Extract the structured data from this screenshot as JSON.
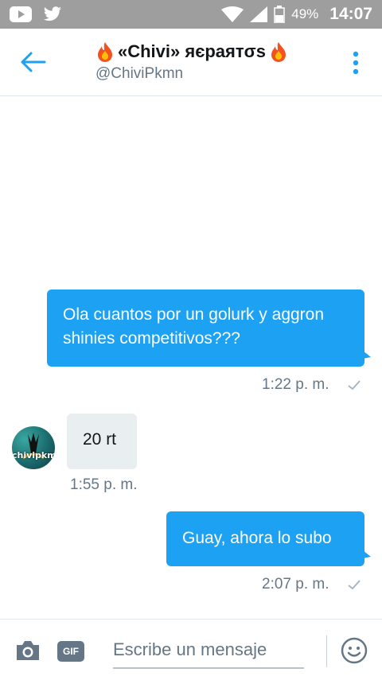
{
  "status_bar": {
    "battery_percent": "49%",
    "time": "14:07"
  },
  "header": {
    "title": "«Chivi» яєраятσѕ",
    "handle": "@ChiviPkmn"
  },
  "messages": [
    {
      "direction": "sent",
      "text": "Ola cuantos por un golurk y aggron shinies competitivos???",
      "time": "1:22 p. m."
    },
    {
      "direction": "received",
      "text": "20 rt",
      "time": "1:55 p. m."
    },
    {
      "direction": "sent",
      "text": "Guay, ahora lo subo",
      "time": "2:07 p. m."
    }
  ],
  "avatar": {
    "label": "chivipkmn"
  },
  "composer": {
    "gif_label": "GIF",
    "placeholder": "Escribe un mensaje"
  },
  "colors": {
    "accent": "#1da1f2",
    "status_bar": "#9e9e9e",
    "received_bubble": "#e9eef1",
    "secondary_text": "#657786"
  }
}
